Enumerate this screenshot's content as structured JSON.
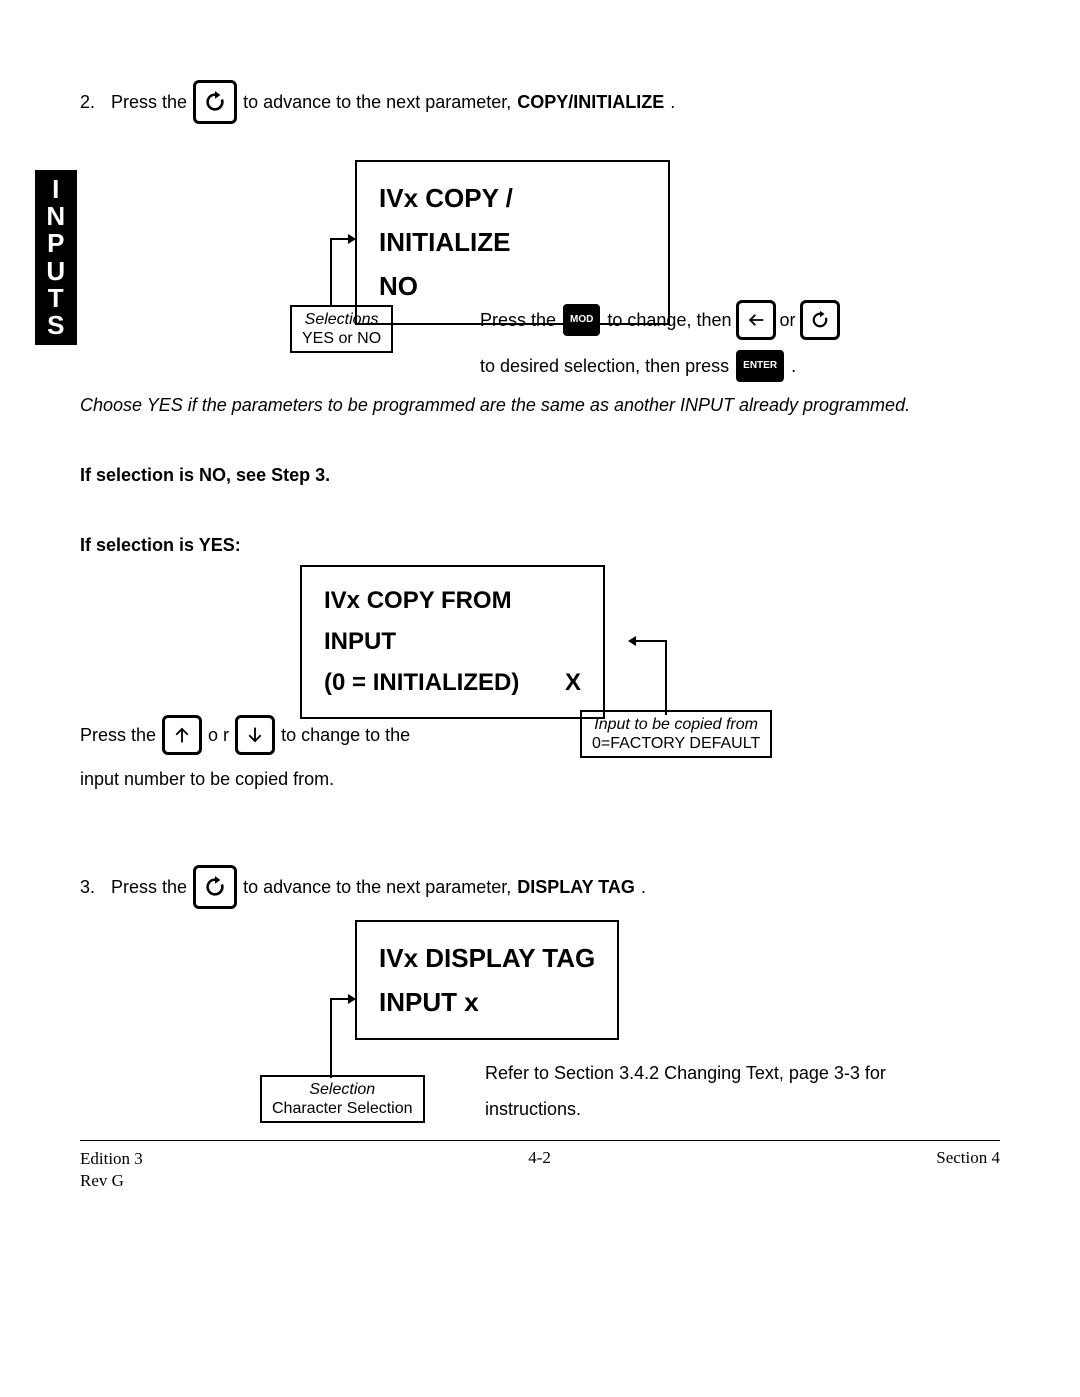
{
  "sidebar_label": "INPUTS",
  "step2": {
    "num": "2.",
    "pre": "Press the",
    "post1": "to advance to the next parameter,",
    "bold": "COPY/INITIALIZE",
    "period": "."
  },
  "display1": {
    "line1": "IVx  COPY / INITIALIZE",
    "line2": "NO"
  },
  "selections1": {
    "title": "Selections",
    "options": "YES or NO"
  },
  "instr1": {
    "press_the": "Press the",
    "to_change_then": "to change, then",
    "or": "or",
    "to_desired": "to desired selection, then press",
    "period": ".",
    "mod": "MOD",
    "enter": "ENTER"
  },
  "choose_note": "Choose YES if the parameters to be programmed are the same as another INPUT already programmed.",
  "if_no": "If  selection is NO, see Step 3.",
  "if_yes": "If selection is YES:",
  "display2": {
    "line1": "IVx  COPY  FROM  INPUT",
    "line2a": "(0 = INITIALIZED)",
    "line2b": "X"
  },
  "copybox": {
    "title": "Input to be copied from",
    "sub": "0=FACTORY DEFAULT"
  },
  "press_updown": {
    "press_the": "Press the",
    "or": "o r",
    "to_change": "to change to the",
    "line2": "input number to be copied from."
  },
  "step3": {
    "num": "3.",
    "pre": "Press the",
    "post1": "to advance to the next parameter,",
    "bold": "DISPLAY TAG",
    "period": "."
  },
  "display3": {
    "line1": "IVx  DISPLAY  TAG",
    "line2": "INPUT  x"
  },
  "selections3": {
    "title": "Selection",
    "options": "Character Selection"
  },
  "refer": "Refer to Section 3.4.2 Changing Text, page 3-3 for instructions.",
  "footer": {
    "edition": "Edition 3",
    "rev": "Rev G",
    "page": "4-2",
    "section": "Section 4"
  }
}
